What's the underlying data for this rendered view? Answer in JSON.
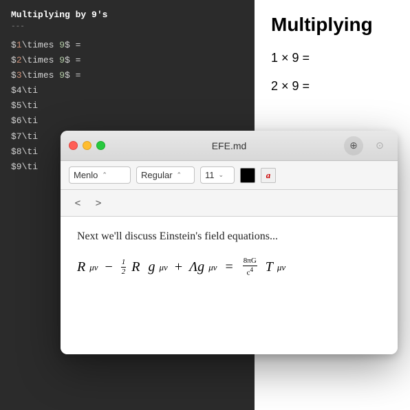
{
  "left_panel": {
    "title": "Multiplying by 9's",
    "divider": "---",
    "lines": [
      "$1\\times 9$ =",
      "$2\\times 9$ =",
      "$3\\times 9$ =",
      "$4\\ti",
      "$5\\ti",
      "$6\\ti",
      "$7\\ti",
      "$8\\ti",
      "$9\\ti"
    ]
  },
  "right_panel": {
    "title": "Multiplying",
    "lines": [
      "1 × 9 =",
      "2 × 9 ="
    ]
  },
  "window": {
    "title": "EFE.md",
    "traffic_lights": [
      "red",
      "yellow",
      "green"
    ],
    "toolbar": {
      "font": "Menlo",
      "style": "Regular",
      "size": "11",
      "color": "#000000",
      "format": "a"
    },
    "content_text": "Next we'll discuss Einstein's field equations...",
    "equation_display": "R_μν − ½ R g_μν + Λg_μν = 8πG/c⁴ T_μν"
  },
  "icons": {
    "zoom_in": "⊕",
    "zoom_out": "⊙",
    "chevron_left": "‹",
    "chevron_right": "›",
    "select_arrow": "⌃"
  }
}
